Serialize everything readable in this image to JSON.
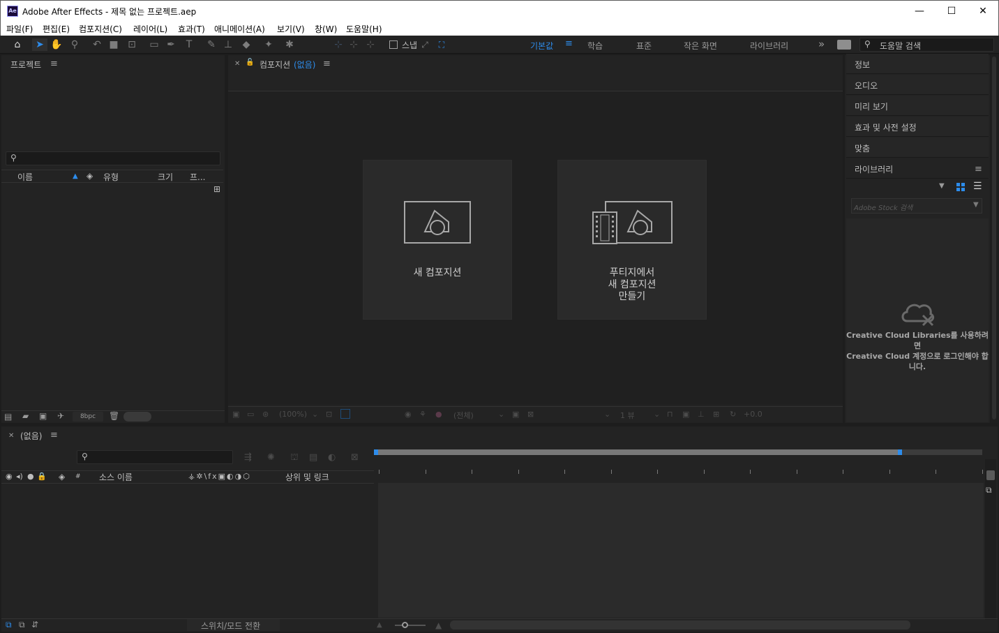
{
  "window": {
    "app_icon": "Ae",
    "title": "Adobe After Effects - 제목 없는 프로젝트.aep",
    "minimize": "—",
    "maximize": "☐",
    "close": "✕"
  },
  "menu": [
    "파일(F)",
    "편집(E)",
    "컴포지션(C)",
    "레이어(L)",
    "효과(T)",
    "애니메이션(A)",
    "보기(V)",
    "창(W)",
    "도움말(H)"
  ],
  "toolbar": {
    "snap_label": "스냅",
    "workspaces": [
      "기본값",
      "학습",
      "표준",
      "작은 화면",
      "라이브러리"
    ],
    "active_workspace": "기본값",
    "overflow": "»",
    "help_search_placeholder": "도움말 검색"
  },
  "project": {
    "title": "프로젝트",
    "columns": {
      "name": "이름",
      "type": "유형",
      "size": "크기",
      "frame": "프..."
    },
    "bpc": "8bpc"
  },
  "composition": {
    "title_prefix": "컴포지션",
    "title_value": "(없음)",
    "card_new": "새 컴포지션",
    "card_footage": [
      "푸티지에서",
      "새 컴포지션",
      "만들기"
    ],
    "viewer_zoom": "(100%)",
    "viewer_res": "(전체)",
    "viewer_view": "1 뷰",
    "exposure": "+0.0"
  },
  "right_panels": [
    "정보",
    "오디오",
    "미리 보기",
    "효과 및 사전 설정",
    "맞춤"
  ],
  "libraries": {
    "title": "라이브러리",
    "stock_placeholder": "Adobe Stock 검색",
    "message_line1": "Creative Cloud Libraries를 사용하려면",
    "message_line2": "Creative Cloud 계정으로 로그인해야 합",
    "message_line3": "니다."
  },
  "timeline": {
    "title": "(없음)",
    "columns": {
      "hash": "#",
      "source_name": "소스 이름",
      "parent": "상위 및 링크"
    },
    "toggle_label": "스위치/모드 전환"
  },
  "colors": {
    "accent": "#2d8ceb",
    "panel_bg": "#232323",
    "app_bg": "#1d1d1d"
  }
}
